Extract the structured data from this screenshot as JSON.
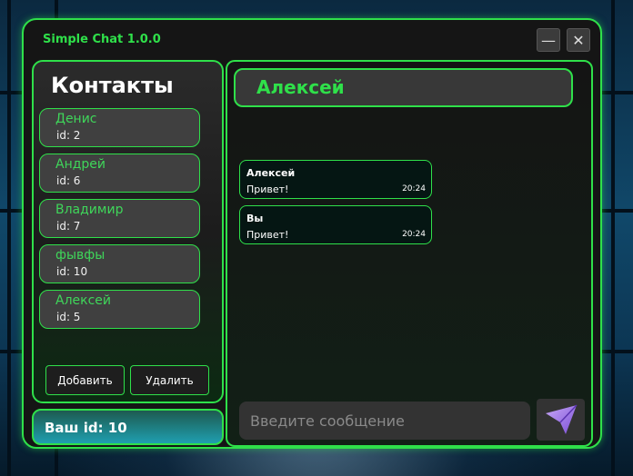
{
  "window": {
    "title": "Simple Chat 1.0.0",
    "minimize_glyph": "—",
    "close_glyph": "✕"
  },
  "contacts": {
    "title": "Контакты",
    "items": [
      {
        "name": "Денис",
        "id": "id: 2"
      },
      {
        "name": "Андрей",
        "id": "id: 6"
      },
      {
        "name": "Владимир",
        "id": "id: 7"
      },
      {
        "name": "фывфы",
        "id": "id: 10"
      },
      {
        "name": "Алексей",
        "id": "id: 5"
      }
    ],
    "add_label": "Добавить",
    "delete_label": "Удалить"
  },
  "my_id": "Ваш id: 10",
  "chat": {
    "header": "Алексей",
    "messages": [
      {
        "author": "Алексей",
        "text": "Привет!",
        "time": "20:24"
      },
      {
        "author": "Вы",
        "text": "Привет!",
        "time": "20:24"
      }
    ],
    "input_placeholder": "Введите сообщение",
    "send_icon": "send-paper-plane-icon"
  },
  "colors": {
    "accent": "#2fe04a",
    "send_icon": "#a77ce6"
  }
}
